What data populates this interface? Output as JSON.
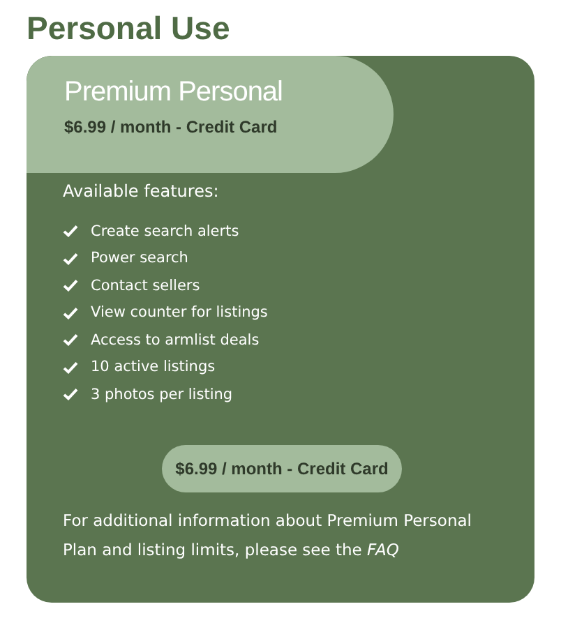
{
  "heading": "Personal Use",
  "plan": {
    "name": "Premium Personal",
    "price": "$6.99 / month - Credit Card"
  },
  "features_label": "Available features:",
  "features": [
    "Create search alerts",
    "Power search",
    "Contact sellers",
    "View counter for listings",
    "Access to armlist deals",
    "10 active listings",
    "3 photos per listing"
  ],
  "button": "$6.99 / month - Credit Card",
  "note": {
    "text": "For additional information about Premium Personal Plan and listing limits, please see the",
    "link": "FAQ"
  }
}
